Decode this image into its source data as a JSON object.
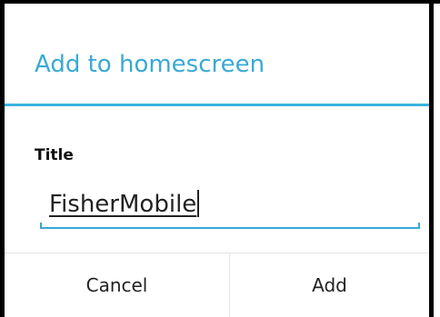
{
  "dialog": {
    "title": "Add to homescreen",
    "field_label": "Title",
    "input_value": "FisherMobile",
    "cancel_label": "Cancel",
    "add_label": "Add"
  },
  "colors": {
    "accent": "#3aa9d4",
    "divider": "#3ab4e0",
    "text": "#222222"
  }
}
